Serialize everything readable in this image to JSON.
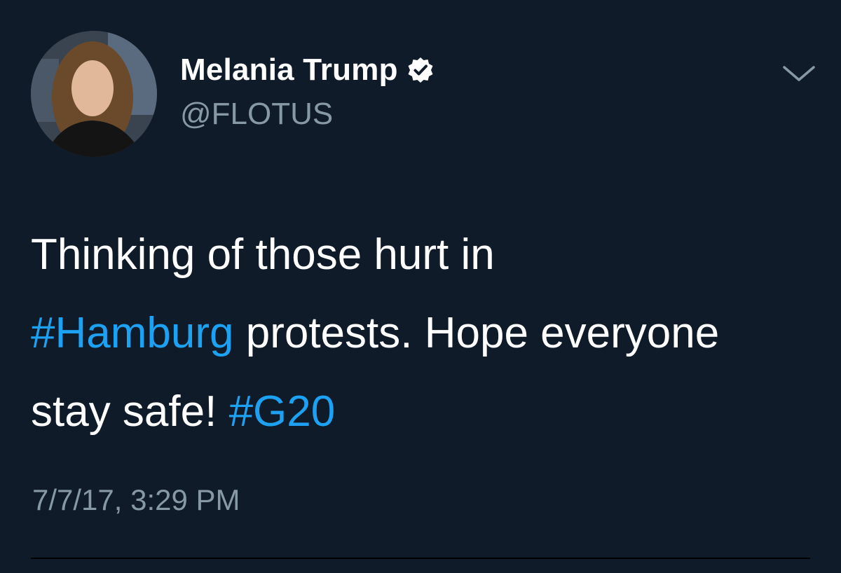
{
  "tweet": {
    "display_name": "Melania Trump",
    "handle": "@FLOTUS",
    "text_part_1": "Thinking of those hurt in ",
    "hashtag_1": "#Hamburg",
    "text_part_2": " protests. Hope everyone stay safe! ",
    "hashtag_2": "#G20",
    "timestamp": "7/7/17, 3:29 PM"
  },
  "icons": {
    "verified": "verified-badge-icon",
    "menu": "chevron-down-icon"
  },
  "colors": {
    "background": "#0f1b28",
    "text": "#ffffff",
    "secondary_text": "#8899a6",
    "link": "#1da1f2"
  }
}
